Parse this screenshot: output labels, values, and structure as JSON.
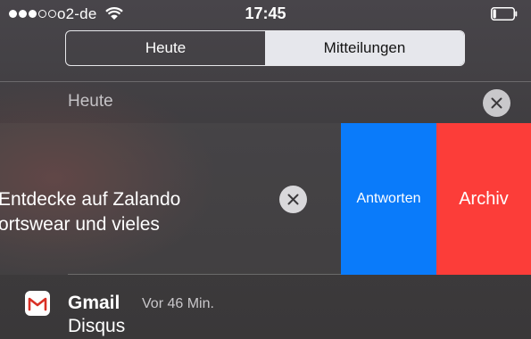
{
  "status_bar": {
    "carrier": "o2-de",
    "time": "17:45",
    "signal_bars_filled": 3,
    "signal_bars_total": 5,
    "battery_level": 0.15
  },
  "tabs": [
    {
      "label": "Heute",
      "active": false
    },
    {
      "label": "Mitteilungen",
      "active": true
    }
  ],
  "section": {
    "title": "Heute"
  },
  "notification": {
    "line1": "Entdecke auf Zalando",
    "line2": "ortswear und vieles",
    "actions": {
      "reply_label": "Antworten",
      "archive_label": "Archiv"
    }
  },
  "gmail": {
    "app_name": "Gmail",
    "timestamp": "Vor 46 Min.",
    "subject": "Disqus"
  },
  "colors": {
    "reply": "#0a7bfa",
    "archive": "#fc3d39",
    "segment_active": "#e6e7ec"
  },
  "icons": [
    "wifi-icon",
    "battery-icon",
    "close-icon",
    "gmail-icon"
  ]
}
